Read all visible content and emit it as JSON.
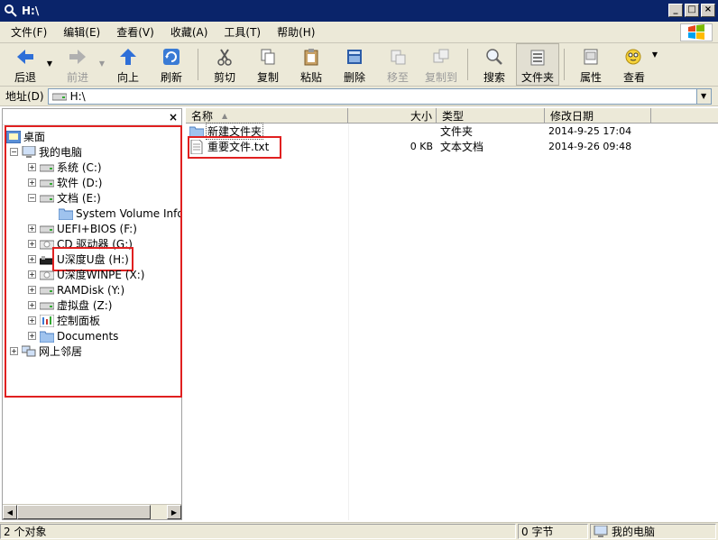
{
  "window": {
    "title": "H:\\"
  },
  "menu": [
    "文件(F)",
    "编辑(E)",
    "查看(V)",
    "收藏(A)",
    "工具(T)",
    "帮助(H)"
  ],
  "toolbar": {
    "back": "后退",
    "forward": "前进",
    "up": "向上",
    "refresh": "刷新",
    "cut": "剪切",
    "copy": "复制",
    "paste": "粘贴",
    "delete": "删除",
    "move_to": "移至",
    "copy_to": "复制到",
    "search": "搜索",
    "folders": "文件夹",
    "properties": "属性",
    "view": "查看"
  },
  "address": {
    "label": "地址(D)",
    "value": "H:\\"
  },
  "tree": {
    "close": "×",
    "items": [
      {
        "label": "桌面",
        "icon": "desktop-icon"
      },
      {
        "label": "我的电脑",
        "icon": "computer-icon"
      },
      {
        "label": "系统 (C:)",
        "icon": "drive-icon"
      },
      {
        "label": "软件 (D:)",
        "icon": "drive-icon"
      },
      {
        "label": "文档 (E:)",
        "icon": "drive-icon"
      },
      {
        "label": "System Volume Information",
        "icon": "folder-icon"
      },
      {
        "label": "UEFI+BIOS (F:)",
        "icon": "drive-icon"
      },
      {
        "label": "CD 驱动器 (G:)",
        "icon": "cd-drive-icon"
      },
      {
        "label": "U深度U盘 (H:)",
        "icon": "usb-drive-icon"
      },
      {
        "label": "U深度WINPE (X:)",
        "icon": "cd-drive-icon"
      },
      {
        "label": "RAMDisk (Y:)",
        "icon": "drive-icon"
      },
      {
        "label": "虚拟盘 (Z:)",
        "icon": "drive-icon"
      },
      {
        "label": "控制面板",
        "icon": "control-panel-icon"
      },
      {
        "label": "Documents",
        "icon": "folder-icon"
      },
      {
        "label": "网上邻居",
        "icon": "network-icon"
      }
    ]
  },
  "list": {
    "columns": {
      "name": "名称",
      "size": "大小",
      "type": "类型",
      "modified": "修改日期"
    },
    "rows": [
      {
        "name": "新建文件夹",
        "size": "",
        "type": "文件夹",
        "modified": "2014-9-25 17:04",
        "icon": "folder-icon"
      },
      {
        "name": "重要文件.txt",
        "size": "0 KB",
        "type": "文本文档",
        "modified": "2014-9-26 09:48",
        "icon": "text-file-icon"
      }
    ]
  },
  "status": {
    "objects": "2 个对象",
    "bytes": "0 字节",
    "location": "我的电脑"
  }
}
